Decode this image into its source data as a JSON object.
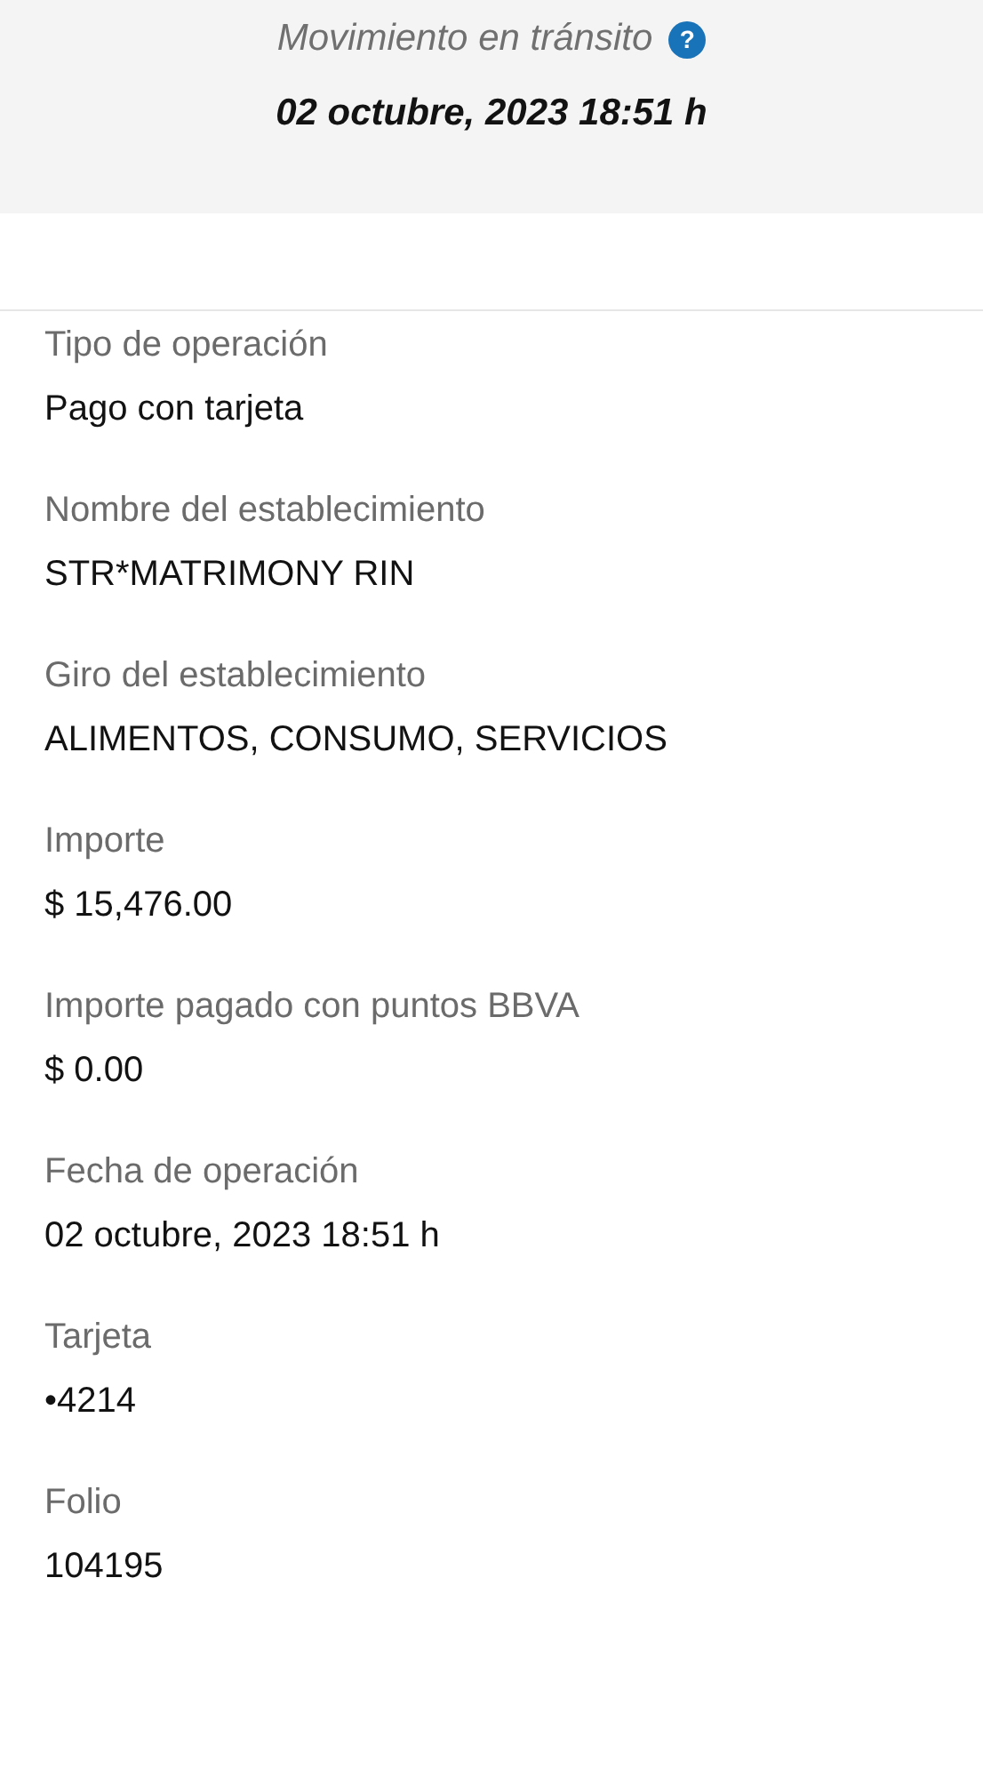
{
  "header": {
    "status": "Movimiento en tránsito",
    "help_icon": "?",
    "date": "02 octubre, 2023 18:51 h"
  },
  "fields": [
    {
      "label": "Tipo de operación",
      "value": "Pago con tarjeta"
    },
    {
      "label": "Nombre del establecimiento",
      "value": "STR*MATRIMONY RIN"
    },
    {
      "label": "Giro del establecimiento",
      "value": "ALIMENTOS, CONSUMO, SERVICIOS"
    },
    {
      "label": "Importe",
      "value": "$ 15,476.00"
    },
    {
      "label": "Importe pagado con puntos BBVA",
      "value": "$ 0.00"
    },
    {
      "label": "Fecha de operación",
      "value": "02 octubre, 2023 18:51 h"
    },
    {
      "label": "Tarjeta",
      "value": "•4214"
    },
    {
      "label": "Folio",
      "value": "104195"
    }
  ]
}
